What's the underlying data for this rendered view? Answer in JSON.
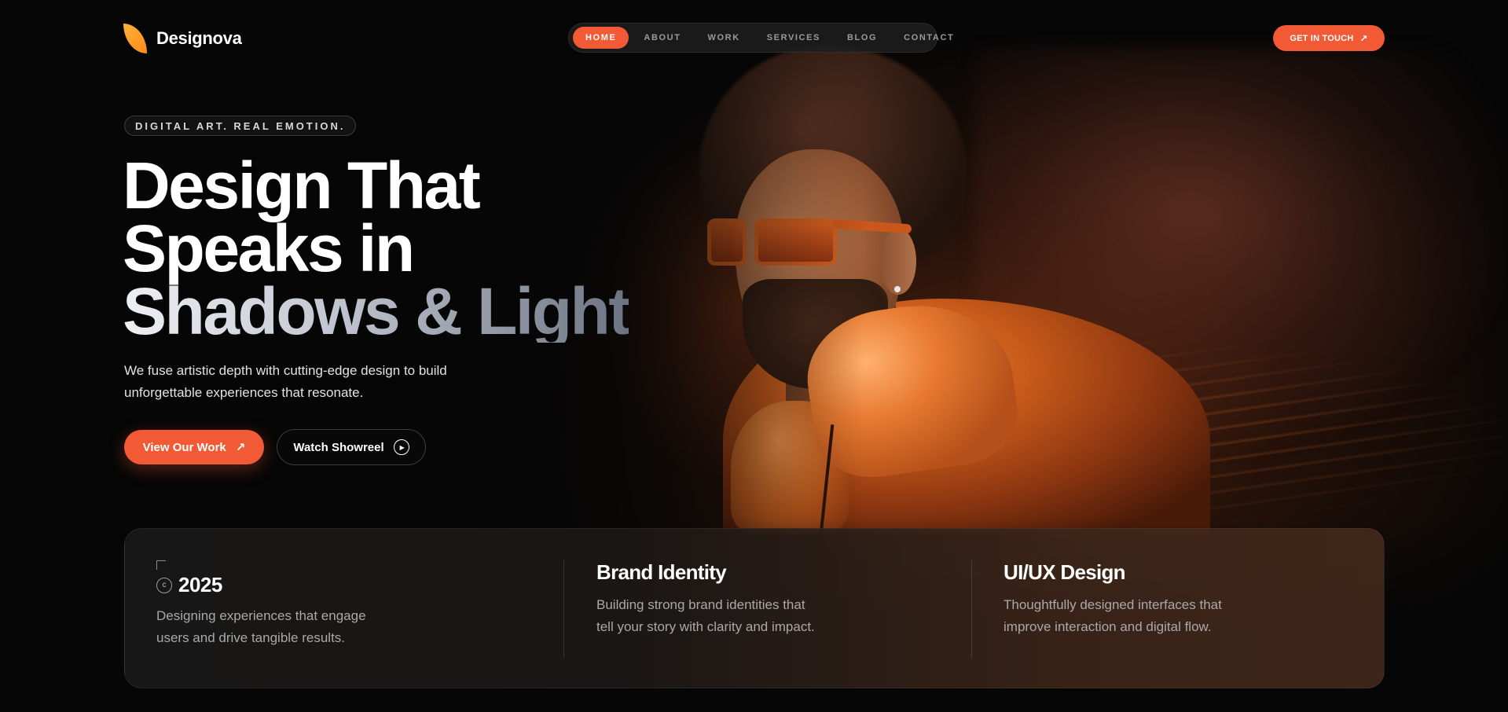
{
  "brand": {
    "name": "Designova",
    "accent": "#f15a35",
    "logo_colors": [
      "#ffb23a",
      "#ff8a1a"
    ]
  },
  "nav": {
    "items": [
      {
        "label": "HOME",
        "active": true
      },
      {
        "label": "ABOUT",
        "active": false
      },
      {
        "label": "WORK",
        "active": false
      },
      {
        "label": "SERVICES",
        "active": false
      },
      {
        "label": "BLOG",
        "active": false
      },
      {
        "label": "CONTACT",
        "active": false
      }
    ],
    "cta": {
      "label": "GET IN TOUCH",
      "icon": "arrow-up-right-icon"
    }
  },
  "hero": {
    "tagline": "DIGITAL ART. REAL EMOTION.",
    "headline": [
      "Design That",
      "Speaks in",
      "Shadows & Light"
    ],
    "subtext": "We fuse artistic depth with cutting-edge design to build unforgettable experiences that resonate.",
    "primary_button": {
      "label": "View Our Work",
      "icon": "arrow-up-right-icon"
    },
    "secondary_button": {
      "label": "Watch Showreel",
      "icon": "play-icon"
    }
  },
  "stats": {
    "year_icon": "copyright-icon",
    "year": "2025",
    "year_description": "Designing experiences that engage users and drive tangible results.",
    "features": [
      {
        "title": "Brand Identity",
        "description": "Building strong brand identities that tell your story with clarity and impact."
      },
      {
        "title": "UI/UX Design",
        "description": "Thoughtfully designed interfaces that improve interaction and digital flow."
      }
    ]
  }
}
